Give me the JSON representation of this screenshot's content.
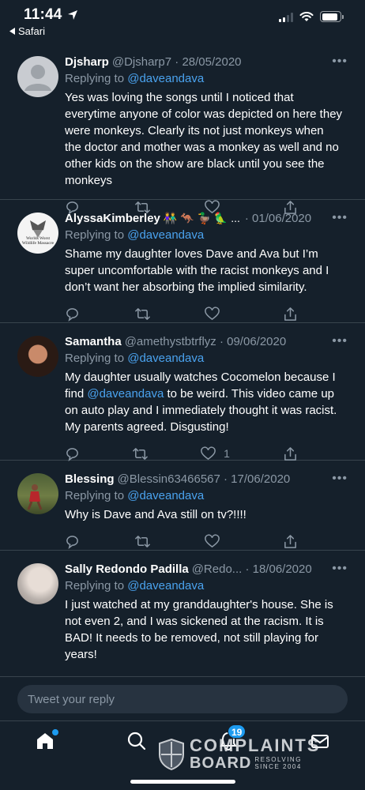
{
  "status_bar": {
    "time": "11:44",
    "back_app": "Safari",
    "battery_level": 0.9,
    "signal_bars_active": 2,
    "signal_bars_total": 4
  },
  "tweets": [
    {
      "name": "Djsharp",
      "meta": "@Djsharp7 · 28/05/2020",
      "reply_prefix": "Replying to",
      "reply_to": "@daveandava",
      "text": "Yes was loving the songs until I noticed that everytime anyone of color was depicted on here they were monkeys. Clearly its not just monkeys when the doctor and mother was a monkey as well and no other kids on the show are black until you see the monkeys",
      "likes": ""
    },
    {
      "name": "AlyssaKimberley",
      "name_emoji": "👫 🦘 🦆 🦜 ...",
      "meta": "· 01/06/2020",
      "avatar_text": "Worlds Worst Wildlife Massacre",
      "reply_prefix": "Replying to",
      "reply_to": "@daveandava",
      "text": "Shame my daughter loves Dave and Ava but I’m super uncomfortable with the racist monkeys and I don’t want her absorbing the implied similarity.",
      "likes": ""
    },
    {
      "name": "Samantha",
      "meta": "@amethystbtrflyz · 09/06/2020",
      "reply_prefix": "Replying to",
      "reply_to": "@daveandava",
      "text_before": "My daughter usually watches Cocomelon because I find ",
      "text_mention": "@daveandava",
      "text_after": " to be weird. This video came up on auto play and I immediately thought it was racist. My parents agreed. Disgusting!",
      "likes": "1"
    },
    {
      "name": "Blessing",
      "meta": "@Blessin63466567 · 17/06/2020",
      "reply_prefix": "Replying to",
      "reply_to": "@daveandava",
      "text": "Why is Dave and Ava still on tv?!!!!",
      "likes": ""
    },
    {
      "name": "Sally Redondo Padilla",
      "meta": "@Redo... · 18/06/2020",
      "reply_prefix": "Replying to",
      "reply_to": "@daveandava",
      "text": "I just watched at my granddaughter's house. She is not even 2, and I was sickened at the racism. It is BAD! It needs to be removed, not still playing for years!",
      "likes": ""
    }
  ],
  "more_glyph": "•••",
  "reply_bar": {
    "placeholder": "Tweet your reply"
  },
  "tab_bar": {
    "notifications_count": "19"
  },
  "watermark": {
    "line1": "COMPLAINTS",
    "line2": "BOARD",
    "tag1": "RESOLVING",
    "tag2": "SINCE 2004"
  },
  "colors": {
    "background": "#15202b",
    "accent": "#1d9bf0",
    "mention": "#4aa2ee",
    "muted": "#8b98a5"
  }
}
